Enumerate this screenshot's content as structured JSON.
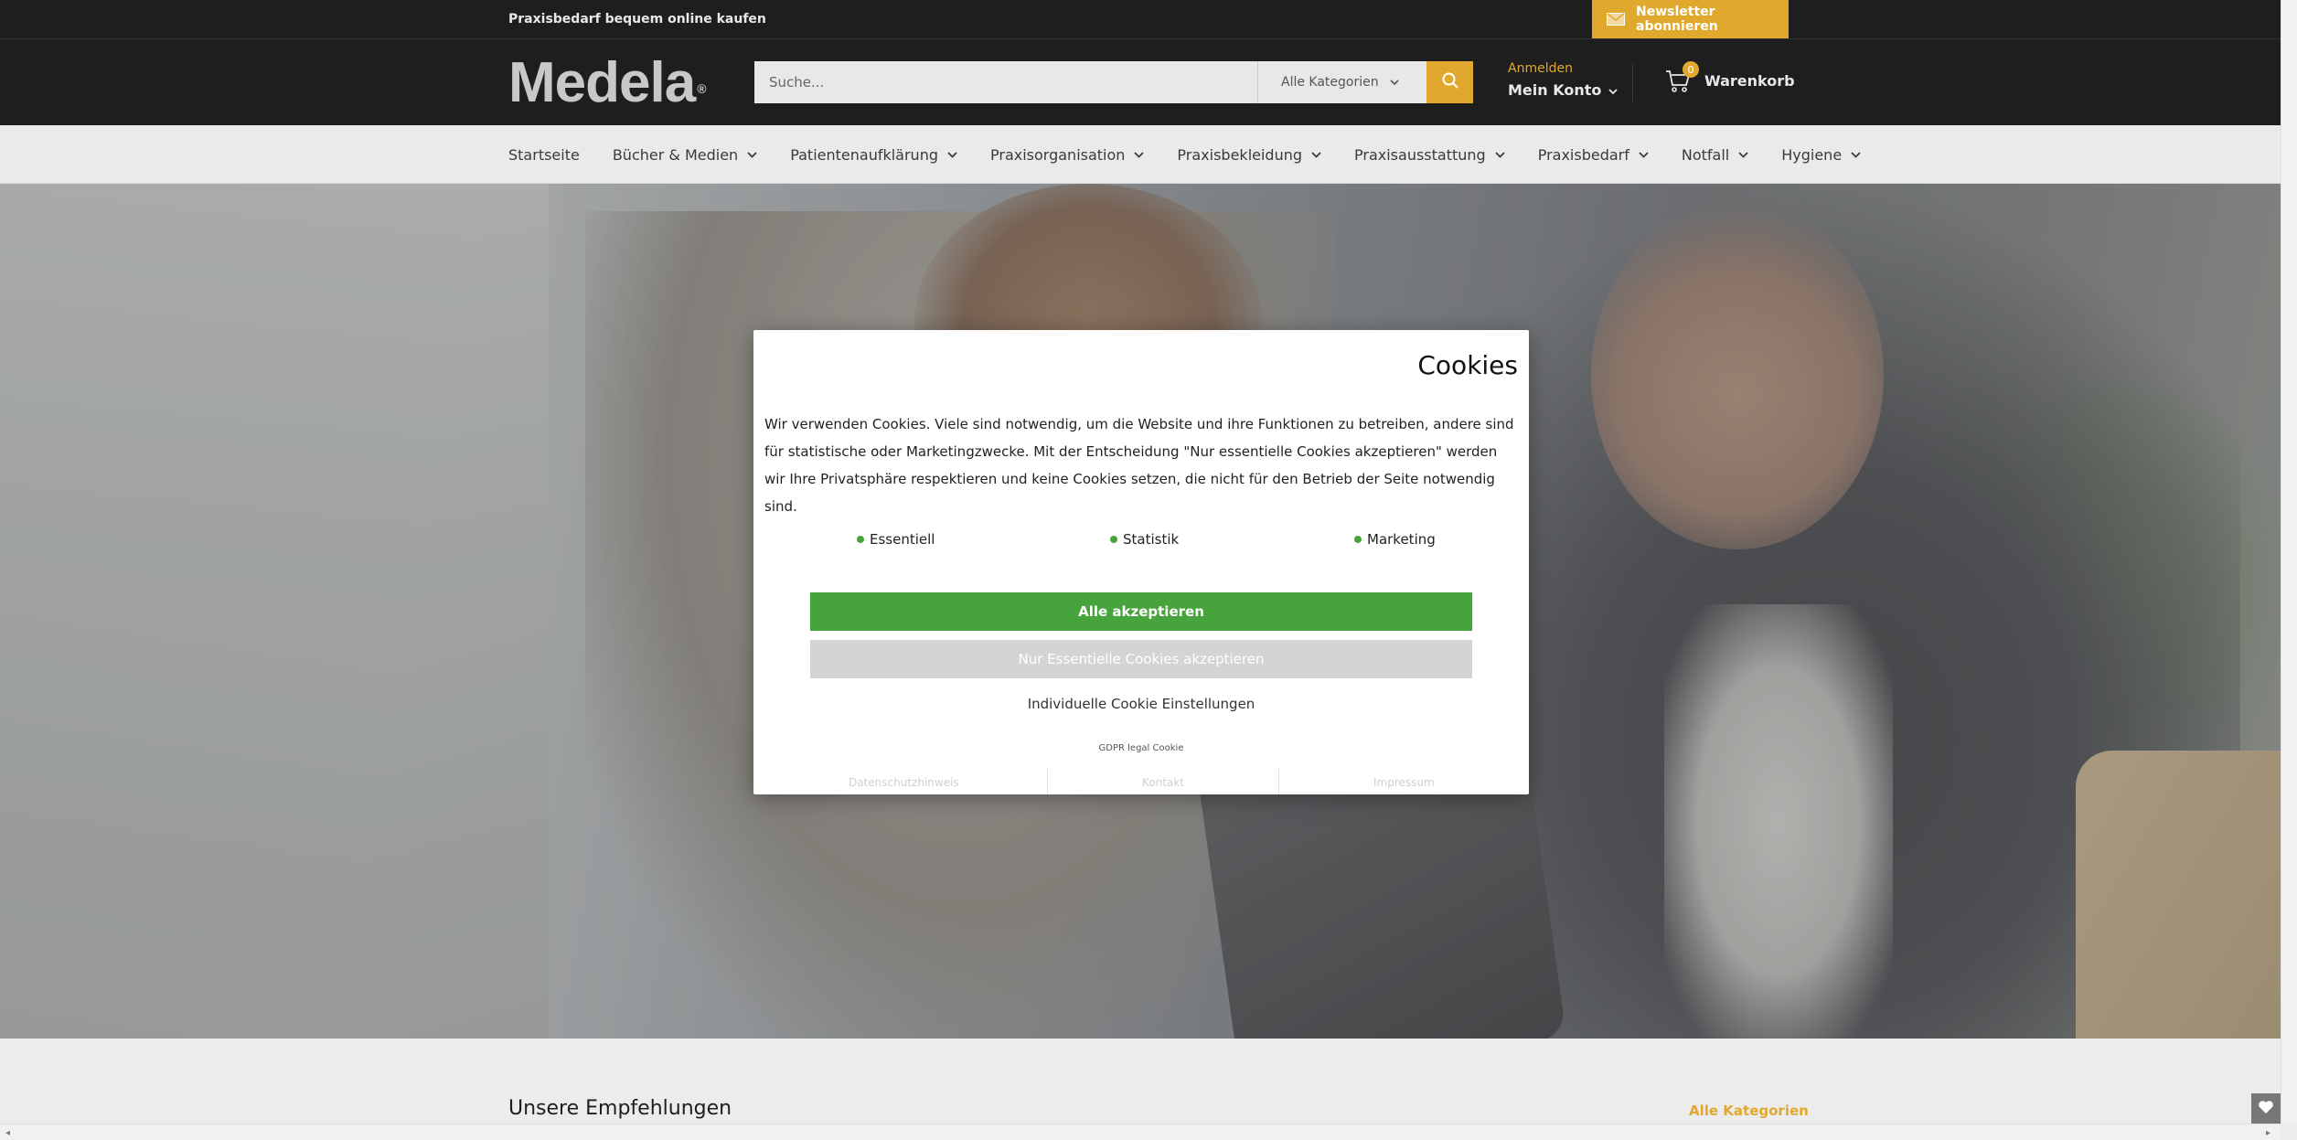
{
  "topbar": {
    "promo": "Praxisbedarf bequem online kaufen",
    "newsletter": "Newsletter abonnieren"
  },
  "header": {
    "logo": "Medela",
    "logo_mark": "®",
    "search_placeholder": "Suche...",
    "category_select": "Alle Kategorien",
    "account_login": "Anmelden",
    "account_label": "Mein Konto",
    "cart_count": "0",
    "cart_label": "Warenkorb"
  },
  "nav": {
    "items": [
      {
        "label": "Startseite",
        "dropdown": false
      },
      {
        "label": "Bücher & Medien",
        "dropdown": true
      },
      {
        "label": "Patientenaufklärung",
        "dropdown": true
      },
      {
        "label": "Praxisorganisation",
        "dropdown": true
      },
      {
        "label": "Praxisbekleidung",
        "dropdown": true
      },
      {
        "label": "Praxisausstattung",
        "dropdown": true
      },
      {
        "label": "Praxisbedarf",
        "dropdown": true
      },
      {
        "label": "Notfall",
        "dropdown": true
      },
      {
        "label": "Hygiene",
        "dropdown": true
      }
    ]
  },
  "cookie_modal": {
    "title": "Cookies",
    "text": "Wir verwenden Cookies. Viele sind notwendig, um die Website und ihre Funktionen zu betreiben, andere sind für statistische oder Marketingzwecke. Mit der Entscheidung \"Nur essentielle Cookies akzeptieren\" werden wir Ihre Privatsphäre respektieren und keine Cookies setzen, die nicht für den Betrieb der Seite notwendig sind.",
    "toggles": [
      {
        "label": "Essentiell"
      },
      {
        "label": "Statistik"
      },
      {
        "label": "Marketing"
      }
    ],
    "accept_all": "Alle akzeptieren",
    "accept_essential": "Nur Essentielle Cookies akzeptieren",
    "individual": "Individuelle Cookie Einstellungen",
    "gdpr": "GDPR legal Cookie",
    "links": [
      "Datenschutzhinweis",
      "Kontakt",
      "Impressum"
    ]
  },
  "recommendations": {
    "title": "Unsere Empfehlungen",
    "all_link": "Alle Kategorien"
  },
  "colors": {
    "accent": "#e1a82e",
    "dark": "#1e1e1e",
    "accept_green": "#47a33b",
    "essential_grey": "#d4d4d4"
  }
}
